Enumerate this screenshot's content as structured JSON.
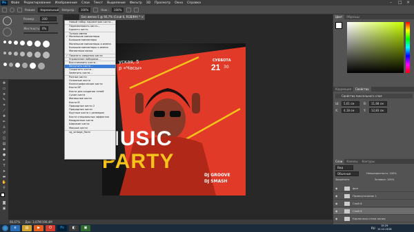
{
  "menubar": {
    "app": "Ps",
    "items": [
      "Файл",
      "Редактирование",
      "Изображение",
      "Слои",
      "Текст",
      "Выделение",
      "Фильтр",
      "3D",
      "Просмотр",
      "Окно",
      "Справка"
    ]
  },
  "options": {
    "mode_label": "Режим:",
    "mode_value": "Нормальный",
    "opacity_label": "Непрозр.:",
    "opacity_value": "100%",
    "flow_label": "Наж.:",
    "flow_value": "100%"
  },
  "brushpanel": {
    "size_label": "Размер:",
    "size_value": "200 пикс.",
    "hardness_label": "Жесткость:",
    "hardness_value": "0%"
  },
  "document": {
    "tab_title": "Без имени-1 @ 66,7% (Слой 6, RGB/8#) * ×"
  },
  "poster": {
    "day": "СУББОТА",
    "date_num": "21",
    "date_sup": "30",
    "line1": "уская, 5",
    "line2": "р «Часы»",
    "title1": "MUSIC",
    "title2": "PARTY",
    "dj1": "DJ GROOVE",
    "dj2": "DJ SMASH"
  },
  "menu": {
    "items": [
      {
        "label": "Новый набор параметров кисти...",
        "sep": false,
        "check": false,
        "sel": false
      },
      {
        "label": "Переименовать кисть...",
        "sep": true,
        "check": false,
        "sel": false
      },
      {
        "label": "Удалить кисть",
        "sep": false,
        "check": false,
        "sel": false
      },
      {
        "label": "Только имена",
        "sep": true,
        "check": false,
        "sel": false
      },
      {
        "label": "Маленькие миниатюры",
        "sep": false,
        "check": true,
        "sel": false
      },
      {
        "label": "Большие миниатюры",
        "sep": false,
        "check": false,
        "sel": false
      },
      {
        "label": "Маленькие миниатюры и имена",
        "sep": false,
        "check": false,
        "sel": false
      },
      {
        "label": "Большие миниатюры и имена",
        "sep": false,
        "check": false,
        "sel": false
      },
      {
        "label": "Миниатюра мазка",
        "sep": false,
        "check": false,
        "sel": false
      },
      {
        "label": "Показать сведения кисти",
        "sep": true,
        "check": true,
        "sel": false
      },
      {
        "label": "Управление наборами...",
        "sep": true,
        "check": false,
        "sel": false
      },
      {
        "label": "Восстановить кисти...",
        "sep": true,
        "check": false,
        "sel": false
      },
      {
        "label": "Загрузить кисти...",
        "sep": false,
        "check": false,
        "sel": true
      },
      {
        "label": "Сохранить кисти...",
        "sep": false,
        "check": false,
        "sel": false
      },
      {
        "label": "Заменить кисти...",
        "sep": false,
        "check": false,
        "sel": false
      },
      {
        "label": "Разные кисти",
        "sep": true,
        "check": false,
        "sel": false
      },
      {
        "label": "Основные кисти",
        "sep": false,
        "check": false,
        "sel": false
      },
      {
        "label": "Каллиграфические кисти",
        "sep": false,
        "check": false,
        "sel": false
      },
      {
        "label": "Кисти DP",
        "sep": false,
        "check": false,
        "sel": false
      },
      {
        "label": "Кисти для создания теней",
        "sep": false,
        "check": false,
        "sel": false
      },
      {
        "label": "Сухие кисти",
        "sep": false,
        "check": false,
        "sel": false
      },
      {
        "label": "Финишные кисти",
        "sep": false,
        "check": false,
        "sel": false
      },
      {
        "label": "Кисти М",
        "sep": false,
        "check": false,
        "sel": false
      },
      {
        "label": "Природные кисти 2",
        "sep": false,
        "check": false,
        "sel": false
      },
      {
        "label": "Природные кисти",
        "sep": false,
        "check": false,
        "sel": false
      },
      {
        "label": "Круглые кисти с размером",
        "sep": false,
        "check": false,
        "sel": false
      },
      {
        "label": "Кисти специальных эффектов",
        "sep": false,
        "check": false,
        "sel": false
      },
      {
        "label": "Квадратные кисти",
        "sep": false,
        "check": false,
        "sel": false
      },
      {
        "label": "Широкие кисти",
        "sep": false,
        "check": false,
        "sel": false
      },
      {
        "label": "Мокрые кисти",
        "sep": false,
        "check": false,
        "sel": false
      },
      {
        "label": "vg_vintage_floral",
        "sep": true,
        "check": false,
        "sel": false
      }
    ]
  },
  "rpanel": {
    "tab_color": "Цвет",
    "tab_swatches": "Образцы",
    "tab_correction": "Коррекция",
    "tab_props": "Свойства",
    "props_title": "Свойства пиксельного слоя",
    "w_label": "Ш:",
    "h_label": "В:",
    "w_val": "5,61 см",
    "h_val": "11,68 см",
    "x_label": "X:",
    "y_label": "Y:",
    "x_val": "4,18 см",
    "y_val": "12,83 см",
    "tab_layers": "Слои",
    "tab_channels": "Каналы",
    "tab_paths": "Контуры",
    "kind": "Вид",
    "blend": "Обычные",
    "opacity": "Непрозрачность: 100%",
    "lock": "Закрепить:",
    "fill": "Заливка: 100%",
    "layers": [
      {
        "name": "фон",
        "selected": false
      },
      {
        "name": "Прямоугольник 1",
        "selected": false
      },
      {
        "name": "Слой 8",
        "selected": false
      },
      {
        "name": "Слой 6",
        "selected": true
      },
      {
        "name": "Кирпичная стена копия",
        "selected": false
      }
    ]
  },
  "status": {
    "zoom": "66,67%",
    "doc": "Док: 3,07M/198,4M"
  },
  "taskbar": {
    "lang": "RU",
    "time": "15:29",
    "date": "12.12.2016"
  },
  "colors": {
    "poster_red": "#e23a28",
    "poster_yellow": "#f5c41b",
    "menu_sel": "#3b7cd6"
  }
}
